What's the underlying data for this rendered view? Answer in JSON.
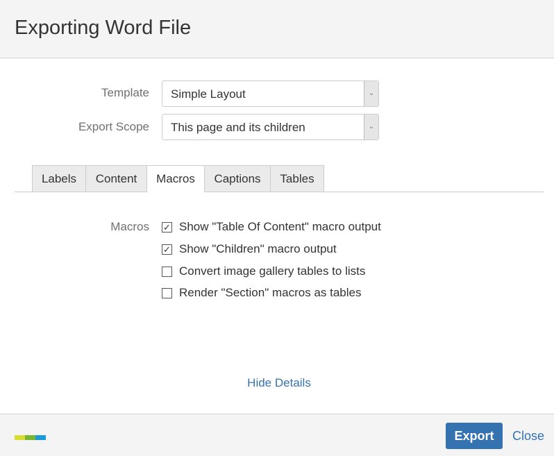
{
  "title": "Exporting Word File",
  "form": {
    "template_label": "Template",
    "template_value": "Simple Layout",
    "scope_label": "Export Scope",
    "scope_value": "This page and its children"
  },
  "tabs": [
    {
      "label": "Labels"
    },
    {
      "label": "Content"
    },
    {
      "label": "Macros",
      "active": true
    },
    {
      "label": "Captions"
    },
    {
      "label": "Tables"
    }
  ],
  "macros": {
    "label": "Macros",
    "options": [
      {
        "label": "Show \"Table Of Content\" macro output",
        "checked": true
      },
      {
        "label": "Show \"Children\" macro output",
        "checked": true
      },
      {
        "label": "Convert image gallery tables to lists",
        "checked": false
      },
      {
        "label": "Render \"Section\" macros as tables",
        "checked": false
      }
    ]
  },
  "hide_details": "Hide Details",
  "footer": {
    "export": "Export",
    "close": "Close",
    "logo_colors": [
      "#d7dd32",
      "#7ab530",
      "#1a9ad6"
    ]
  },
  "accent": "#3572b0"
}
